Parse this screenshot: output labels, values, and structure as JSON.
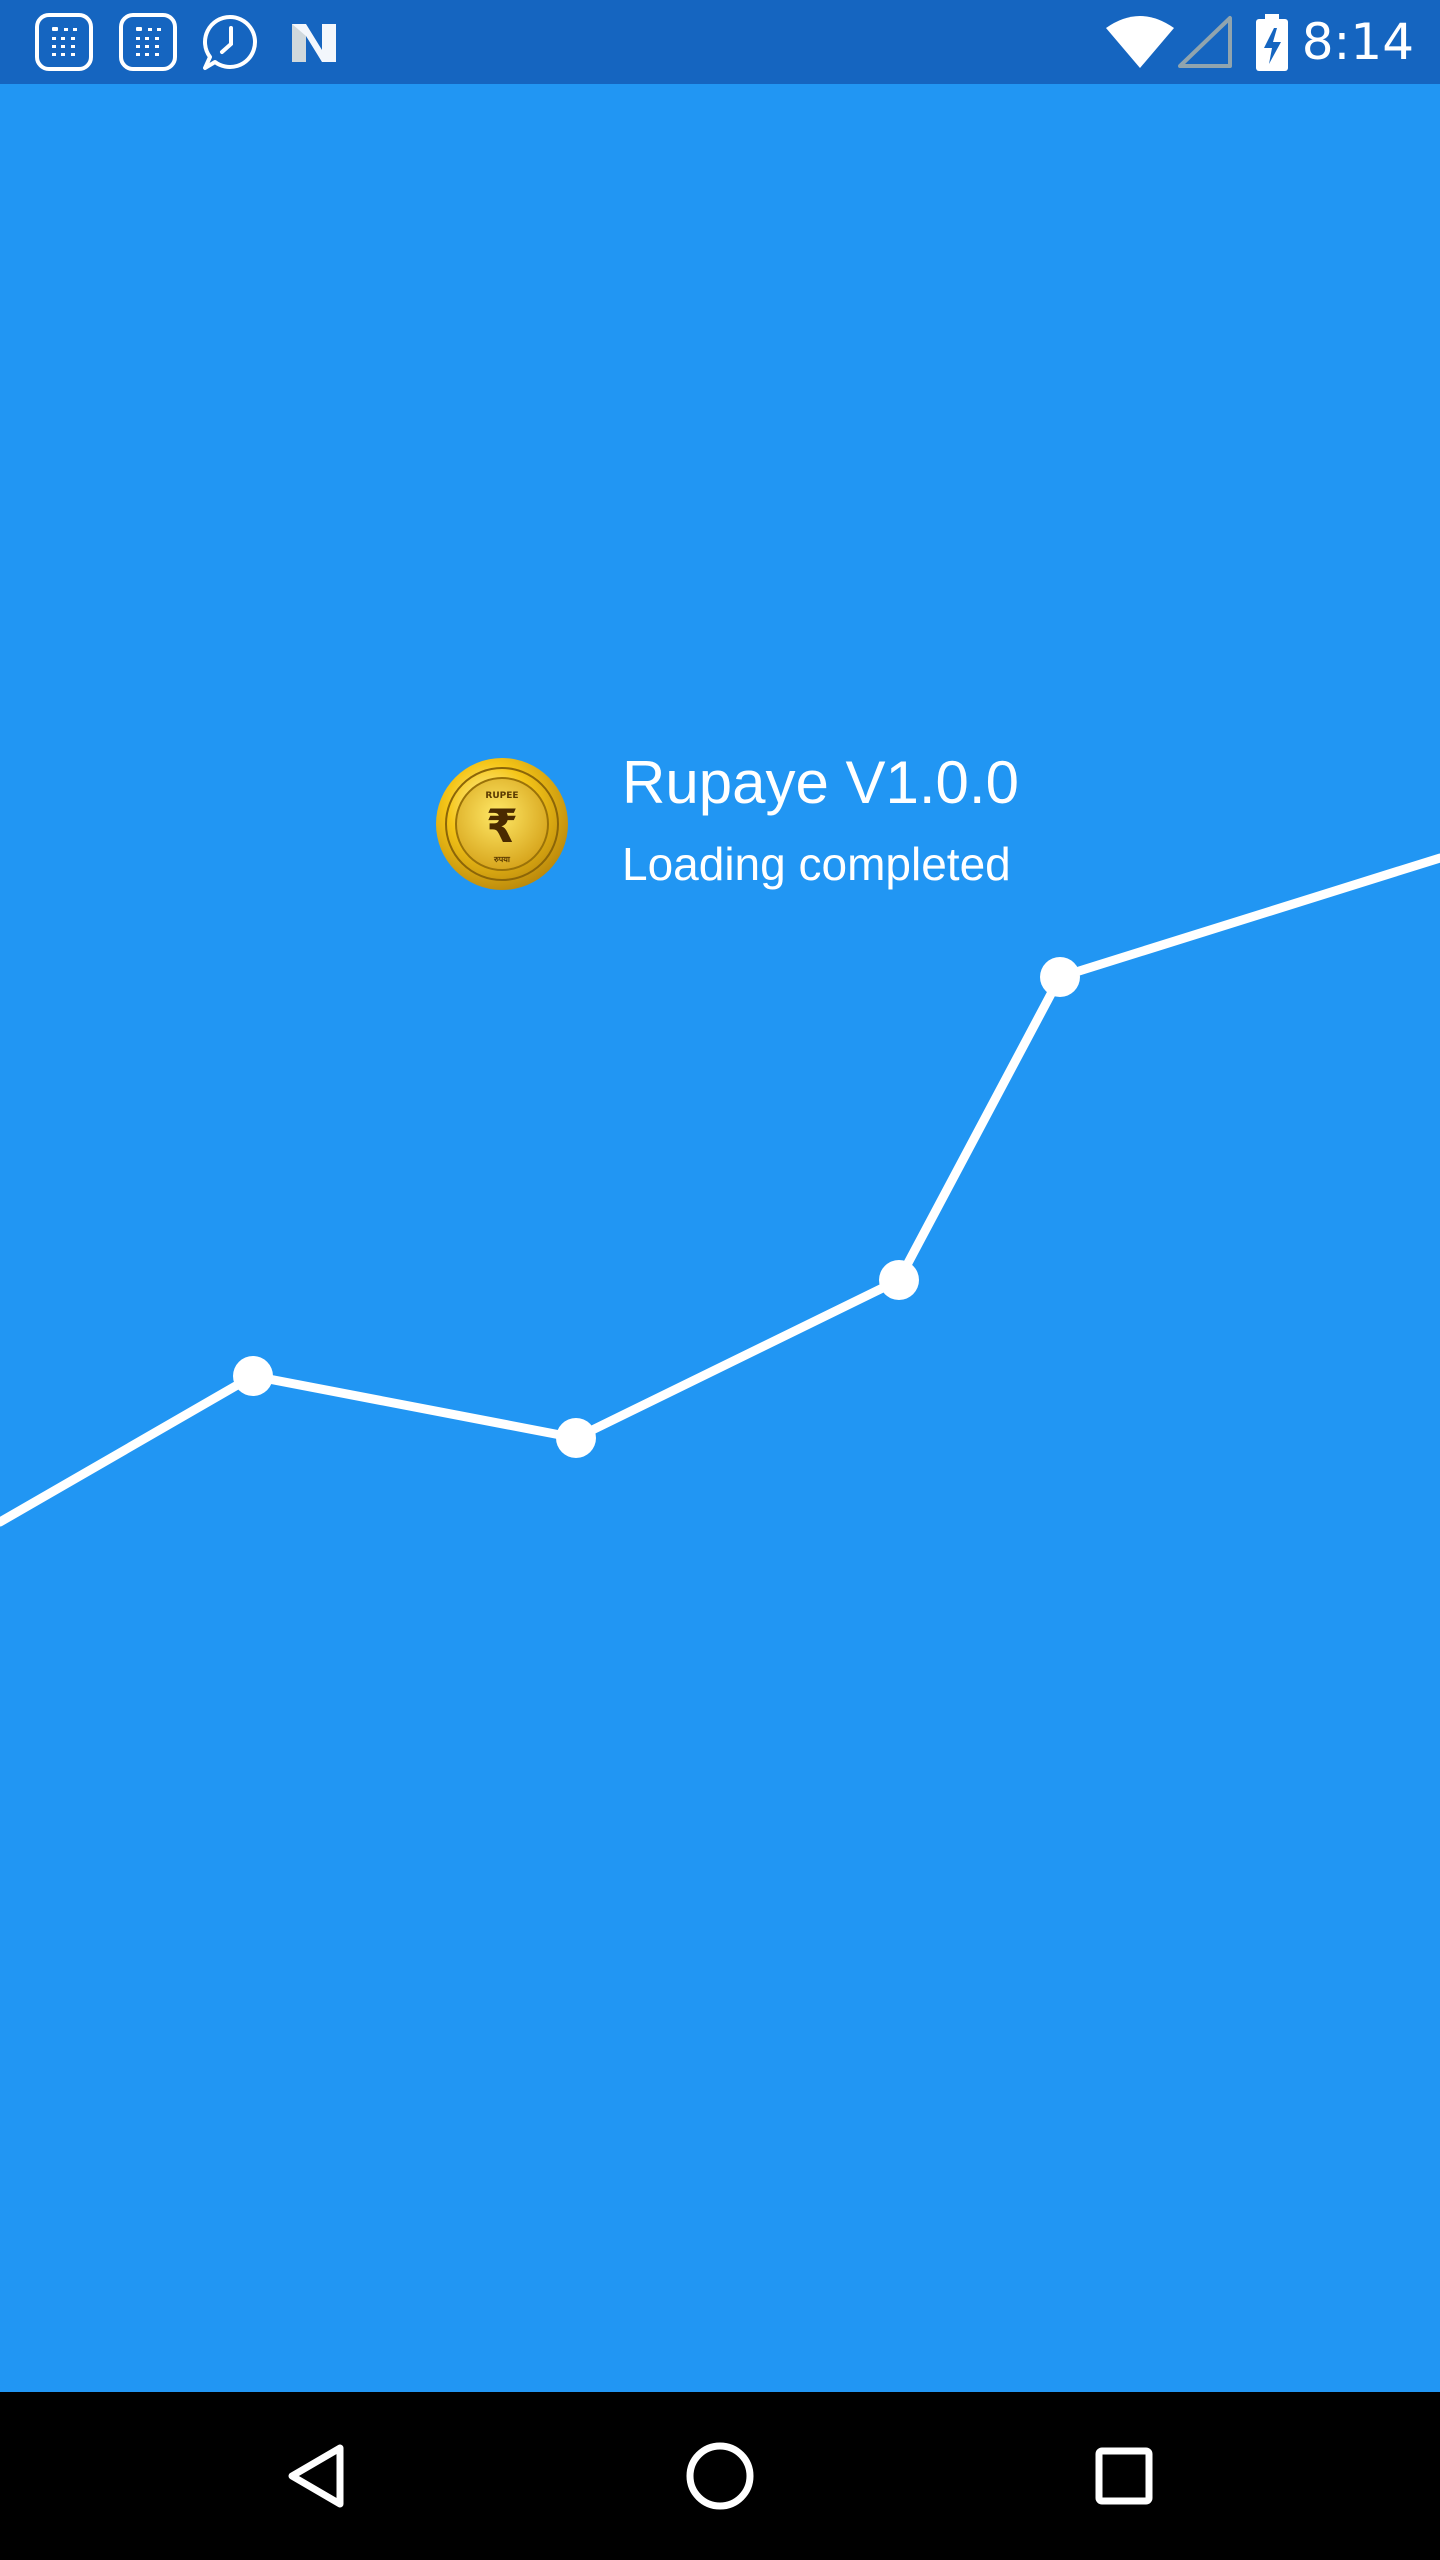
{
  "status_bar": {
    "time": "8:14",
    "left_icons": [
      "calculator-app-icon",
      "calculator-app-icon",
      "whatsapp-icon",
      "n-logo-icon"
    ],
    "right_icons": [
      "wifi-icon",
      "cell-signal-icon",
      "battery-charging-icon"
    ]
  },
  "splash": {
    "app_title": "Rupaye V1.0.0",
    "status_text": "Loading completed",
    "logo_icon": "rupee-coin-icon",
    "logo_text_top": "RUPEE",
    "logo_text_bottom": "रुपया",
    "logo_symbol": "₹",
    "decorative_line_points": 6
  },
  "navigation_bar": {
    "buttons": [
      "back-icon",
      "home-icon",
      "recents-icon"
    ]
  },
  "colors": {
    "background": "#2196F3",
    "status_bar": "#1565C0",
    "nav_bar": "#000000",
    "text": "#FFFFFF",
    "coin_gold": "#E8B923"
  }
}
